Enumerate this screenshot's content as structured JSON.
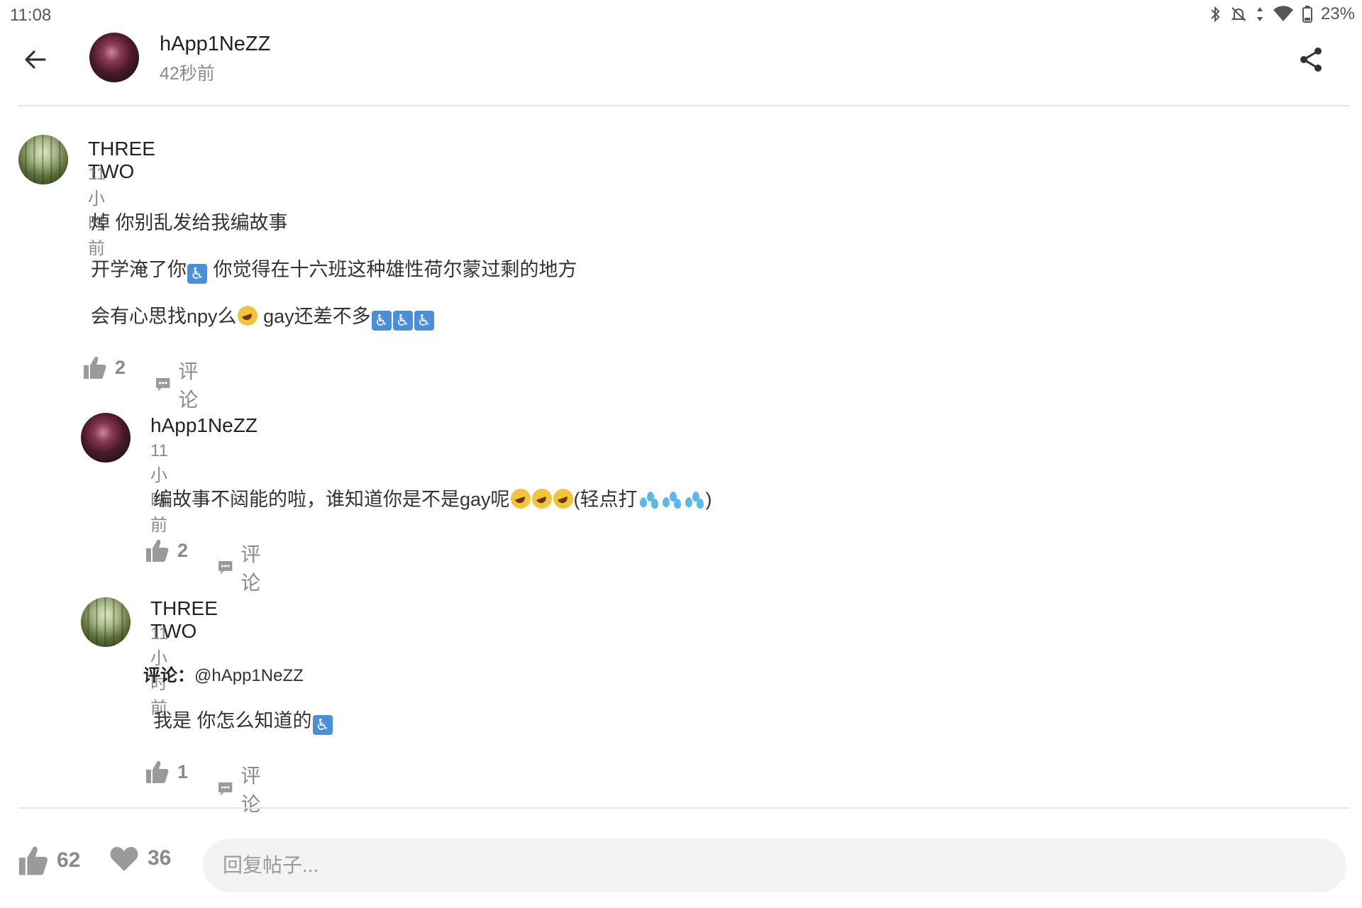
{
  "status_bar": {
    "time": "11:08",
    "battery": "23%",
    "icons": [
      "bluetooth-icon",
      "mute-notification-icon",
      "data-arrows-icon",
      "wifi-icon",
      "battery-icon"
    ]
  },
  "header": {
    "author": "hApp1NeZZ",
    "time": "42秒前",
    "icons": [
      "back-arrow-icon",
      "share-icon"
    ]
  },
  "comments": [
    {
      "name": "THREE TWO",
      "time": "11小时前",
      "lines": [
        "焯 你别乱发给我编故事",
        "开学淹了你",
        "你觉得在十六班这种雄性荷尔蒙过剩的地方",
        "会有心思找npy么",
        "gay还差不多"
      ],
      "likes": "2",
      "comment_label": "评论"
    },
    {
      "name": "hApp1NeZZ",
      "time": "11小时前",
      "lines": [
        "编故事不闼能的啦，谁知道你是不是gay呢",
        "(轻点打",
        ")"
      ],
      "likes": "2",
      "comment_label": "评论"
    },
    {
      "name": "THREE TWO",
      "time": "11小时前",
      "reply_prefix": "评论：",
      "reply_to": "@hApp1NeZZ",
      "lines": [
        "我是 你怎么知道的"
      ],
      "likes": "1",
      "comment_label": "评论"
    }
  ],
  "bottom_bar": {
    "likes": "62",
    "hearts": "36",
    "reply_placeholder": "回复帖子..."
  },
  "colors": {
    "muted_text": "#8a8a8a",
    "input_bg": "#f2f3f3",
    "divider": "#e6e6e6",
    "accessibility_emoji": "#4a8fd8"
  }
}
